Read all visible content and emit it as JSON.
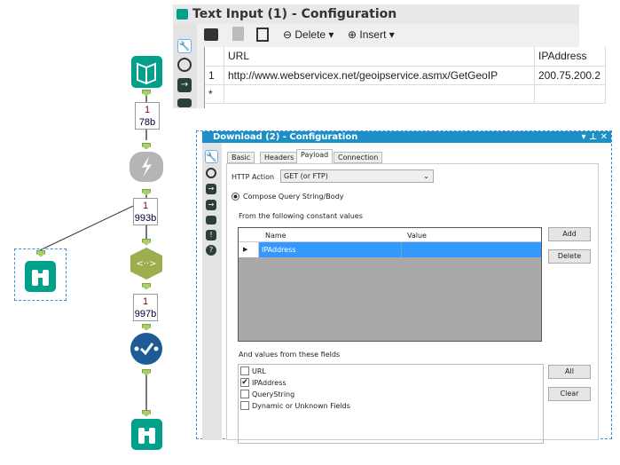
{
  "workflow": {
    "connections": [
      {
        "records": "1",
        "size": "78b"
      },
      {
        "records": "1",
        "size": "993b"
      },
      {
        "records": "1",
        "size": "997b"
      }
    ]
  },
  "text_input": {
    "title": "Text Input (1) - Configuration",
    "toolbar": {
      "delete_label": "Delete",
      "insert_label": "Insert"
    },
    "columns": [
      "URL",
      "IPAddress"
    ],
    "rows": [
      {
        "num": "1",
        "url": "http://www.webservicex.net/geoipservice.asmx/GetGeoIP",
        "ip": "200.75.200.2"
      }
    ],
    "new_row_marker": "*"
  },
  "download": {
    "title": "Download (2) - Configuration",
    "tabs": [
      "Basic",
      "Headers",
      "Payload",
      "Connection"
    ],
    "active_tab": "Payload",
    "http_action_label": "HTTP Action",
    "http_action_value": "GET (or FTP)",
    "compose_label": "Compose Query String/Body",
    "constant_label": "From the following constant values",
    "grid_columns": [
      "Name",
      "Value"
    ],
    "grid_rows": [
      {
        "name": "IPAddress",
        "value": ""
      }
    ],
    "add_label": "Add",
    "delete_label": "Delete",
    "fields_label": "And values from these fields",
    "fields": [
      {
        "label": "URL",
        "checked": false
      },
      {
        "label": "IPAddress",
        "checked": true
      },
      {
        "label": "QueryString",
        "checked": false
      },
      {
        "label": "Dynamic or Unknown Fields",
        "checked": false
      }
    ],
    "all_label": "All",
    "clear_label": "Clear",
    "accent": "#1b8fc6"
  }
}
